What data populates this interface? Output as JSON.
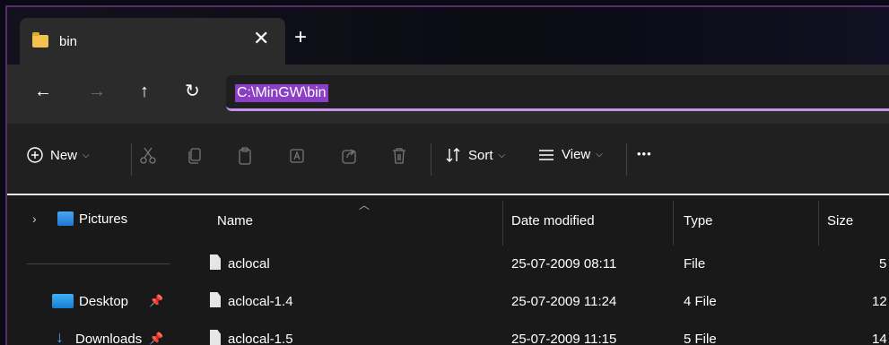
{
  "tab": {
    "title": "bin",
    "close": "✕",
    "new": "+"
  },
  "nav": {
    "back": "←",
    "forward": "→",
    "up": "↑",
    "refresh": "↻"
  },
  "address": {
    "value": "C:\\MinGW\\bin"
  },
  "toolbar": {
    "new_label": "New",
    "sort_label": "Sort",
    "view_label": "View",
    "more": "•••",
    "chevron": "⌵"
  },
  "sidebar": {
    "items": [
      {
        "label": "Pictures",
        "chevron": "›"
      },
      {
        "label": "Desktop",
        "pin": "📌"
      },
      {
        "label": "Downloads",
        "pin": "📌"
      }
    ]
  },
  "columns": {
    "name": "Name",
    "date": "Date modified",
    "type": "Type",
    "size": "Size"
  },
  "files": [
    {
      "name": "aclocal",
      "date": "25-07-2009 08:11",
      "type": "File",
      "size": "5"
    },
    {
      "name": "aclocal-1.4",
      "date": "25-07-2009 11:24",
      "type": "4 File",
      "size": "12"
    },
    {
      "name": "aclocal-1.5",
      "date": "25-07-2009 11:15",
      "type": "5 File",
      "size": "14"
    }
  ],
  "colors": {
    "accent": "#c792ea",
    "selection": "#8a3fc4",
    "folder": "#f2c14e"
  }
}
